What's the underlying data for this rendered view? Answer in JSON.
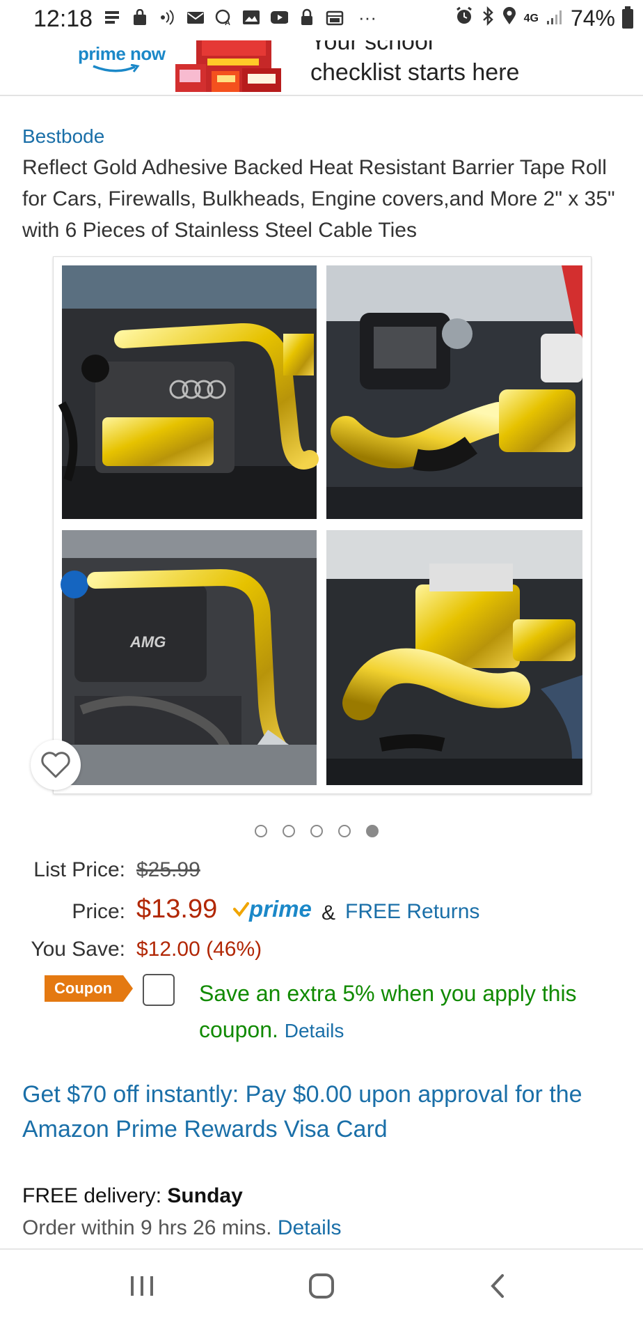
{
  "status_bar": {
    "time": "12:18",
    "battery": "74%",
    "network": "4G",
    "left_icons": [
      "menu-icon",
      "bag-icon",
      "cast-icon",
      "mail-icon",
      "sync-icon",
      "image-icon",
      "youtube-icon",
      "lock-icon",
      "calendar-icon",
      "more-icon"
    ],
    "right_icons": [
      "alarm-icon",
      "bluetooth-icon",
      "location-icon",
      "signal-icon",
      "battery-icon"
    ],
    "overflow": "···"
  },
  "banner": {
    "logo_text": "prime now",
    "line1": "Your school",
    "line2": "checklist starts here"
  },
  "product": {
    "brand": "Bestbode",
    "title": "Reflect Gold Adhesive Backed Heat Resistant Barrier Tape Roll for Cars, Firewalls, Bulkheads, Engine covers,and More 2\" x 35\" with 6 Pieces of Stainless Steel Cable Ties",
    "carousel": {
      "count": 5,
      "active_index": 4
    }
  },
  "pricing": {
    "list_price_label": "List Price:",
    "list_price": "$25.99",
    "price_label": "Price:",
    "price": "$13.99",
    "prime_label": "prime",
    "ampersand": "&",
    "free_returns": "FREE Returns",
    "you_save_label": "You Save:",
    "you_save": "$12.00 (46%)"
  },
  "coupon": {
    "badge": "Coupon",
    "text": "Save an extra 5% when you apply this coupon.",
    "details": "Details"
  },
  "promo": {
    "text": "Get $70 off instantly: Pay $0.00 upon approval for the Amazon Prime Rewards Visa Card"
  },
  "delivery": {
    "prefix": "FREE delivery:",
    "day": "Sunday",
    "order_within": "Order within 9 hrs 26 mins.",
    "details": "Details"
  },
  "colors": {
    "link": "#1a6fa8",
    "price_red": "#b12704",
    "coupon_orange": "#e47911",
    "coupon_green": "#108a00",
    "prime_blue": "#1b88c8"
  }
}
